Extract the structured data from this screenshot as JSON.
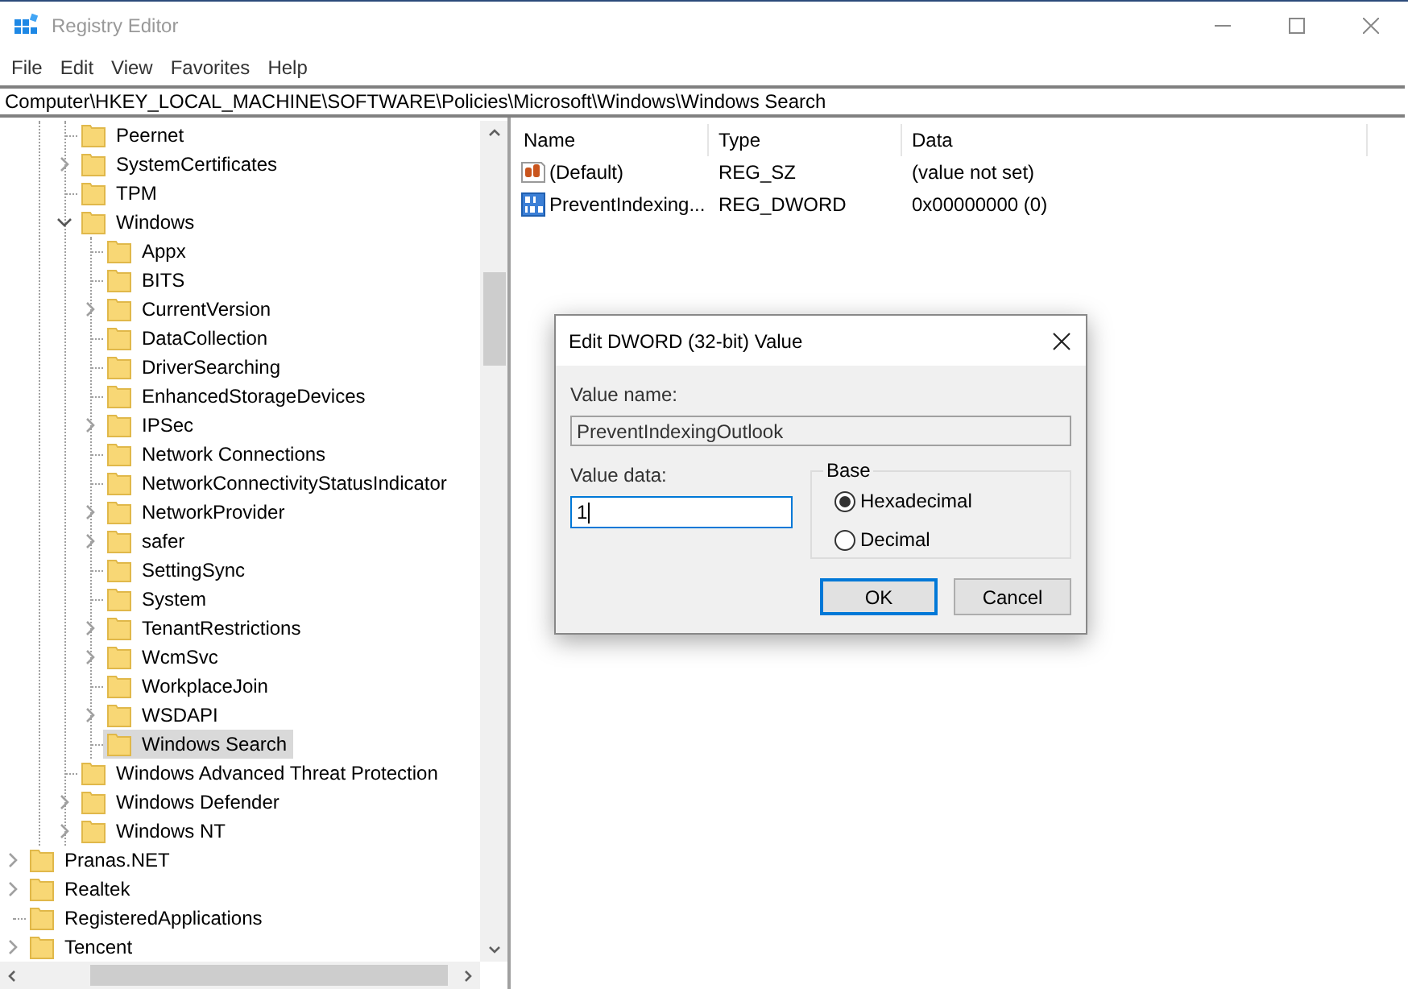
{
  "window": {
    "title": "Registry Editor"
  },
  "menu": [
    "File",
    "Edit",
    "View",
    "Favorites",
    "Help"
  ],
  "address_bar": {
    "value": "Computer\\HKEY_LOCAL_MACHINE\\SOFTWARE\\Policies\\Microsoft\\Windows\\Windows Search"
  },
  "tree": [
    {
      "children": [
        {
          "children": [
            {
              "label": "Peernet",
              "kind": "leaf",
              "selected": false
            },
            {
              "label": "SystemCertificates",
              "kind": "branch",
              "expanded": false,
              "selected": false
            },
            {
              "label": "TPM",
              "kind": "leaf",
              "selected": false
            },
            {
              "label": "Windows",
              "kind": "branch",
              "expanded": true,
              "selected": false,
              "children": [
                {
                  "label": "Appx",
                  "kind": "leaf",
                  "selected": false
                },
                {
                  "label": "BITS",
                  "kind": "leaf",
                  "selected": false
                },
                {
                  "label": "CurrentVersion",
                  "kind": "branch",
                  "expanded": false,
                  "selected": false
                },
                {
                  "label": "DataCollection",
                  "kind": "leaf",
                  "selected": false
                },
                {
                  "label": "DriverSearching",
                  "kind": "leaf",
                  "selected": false
                },
                {
                  "label": "EnhancedStorageDevices",
                  "kind": "leaf",
                  "selected": false
                },
                {
                  "label": "IPSec",
                  "kind": "branch",
                  "expanded": false,
                  "selected": false
                },
                {
                  "label": "Network Connections",
                  "kind": "leaf",
                  "selected": false
                },
                {
                  "label": "NetworkConnectivityStatusIndicator",
                  "kind": "leaf",
                  "selected": false
                },
                {
                  "label": "NetworkProvider",
                  "kind": "branch",
                  "expanded": false,
                  "selected": false
                },
                {
                  "label": "safer",
                  "kind": "branch",
                  "expanded": false,
                  "selected": false
                },
                {
                  "label": "SettingSync",
                  "kind": "leaf",
                  "selected": false
                },
                {
                  "label": "System",
                  "kind": "leaf",
                  "selected": false
                },
                {
                  "label": "TenantRestrictions",
                  "kind": "branch",
                  "expanded": false,
                  "selected": false
                },
                {
                  "label": "WcmSvc",
                  "kind": "branch",
                  "expanded": false,
                  "selected": false
                },
                {
                  "label": "WorkplaceJoin",
                  "kind": "leaf",
                  "selected": false
                },
                {
                  "label": "WSDAPI",
                  "kind": "branch",
                  "expanded": false,
                  "selected": false
                },
                {
                  "label": "Windows Search",
                  "kind": "leaf",
                  "selected": true
                }
              ]
            },
            {
              "label": "Windows Advanced Threat Protection",
              "kind": "leaf",
              "selected": false
            },
            {
              "label": "Windows Defender",
              "kind": "branch",
              "expanded": false,
              "selected": false
            },
            {
              "label": "Windows NT",
              "kind": "branch",
              "expanded": false,
              "selected": false
            }
          ]
        }
      ]
    },
    {
      "label": "Pranas.NET",
      "kind": "branch",
      "expanded": false,
      "selected": false
    },
    {
      "label": "Realtek",
      "kind": "branch",
      "expanded": false,
      "selected": false
    },
    {
      "label": "RegisteredApplications",
      "kind": "leaf",
      "selected": false
    },
    {
      "label": "Tencent",
      "kind": "branch",
      "expanded": false,
      "selected": false
    }
  ],
  "values_list": {
    "columns": [
      "Name",
      "Type",
      "Data"
    ],
    "rows": [
      {
        "kind": "string",
        "name": "(Default)",
        "type": "REG_SZ",
        "data": "(value not set)"
      },
      {
        "kind": "binary",
        "name": "PreventIndexing...",
        "type": "REG_DWORD",
        "data": "0x00000000 (0)"
      }
    ]
  },
  "dialog": {
    "title": "Edit DWORD (32-bit) Value",
    "value_name_label": "Value name:",
    "value_name": "PreventIndexingOutlook",
    "value_data_label": "Value data:",
    "value_data": "1",
    "base_label": "Base",
    "base_options": [
      {
        "label": "Hexadecimal",
        "selected": true
      },
      {
        "label": "Decimal",
        "selected": false
      }
    ],
    "buttons": [
      {
        "label": "OK",
        "default": true
      },
      {
        "label": "Cancel",
        "default": false
      }
    ]
  }
}
